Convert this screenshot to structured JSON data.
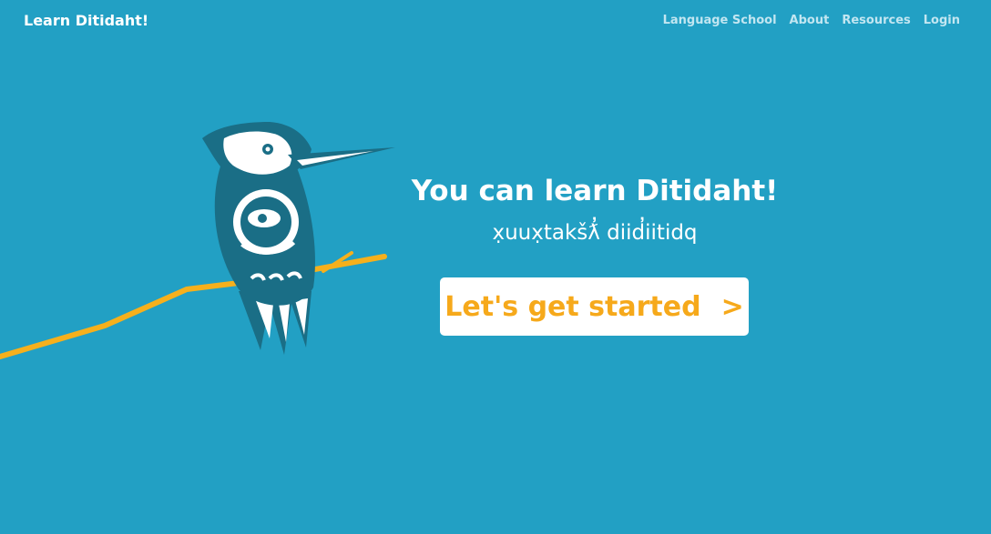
{
  "header": {
    "brand": "Learn Ditidaht!",
    "nav": [
      "Language School",
      "About",
      "Resources",
      "Login"
    ]
  },
  "hero": {
    "headline": "You can learn Ditidaht!",
    "subline": "x̣uux̣takšƛ̓ diid̓iitidq",
    "cta_label": "Let's get started",
    "cta_arrow": ">"
  },
  "icons": {
    "bird": "kingfisher-illustration-icon",
    "branch": "branch-icon"
  },
  "colors": {
    "background": "#22a0c4",
    "cta_text": "#f6a91b",
    "branch": "#f6b01c",
    "bird_dark": "#1a6e86",
    "nav_text": "#c2e6f1"
  }
}
